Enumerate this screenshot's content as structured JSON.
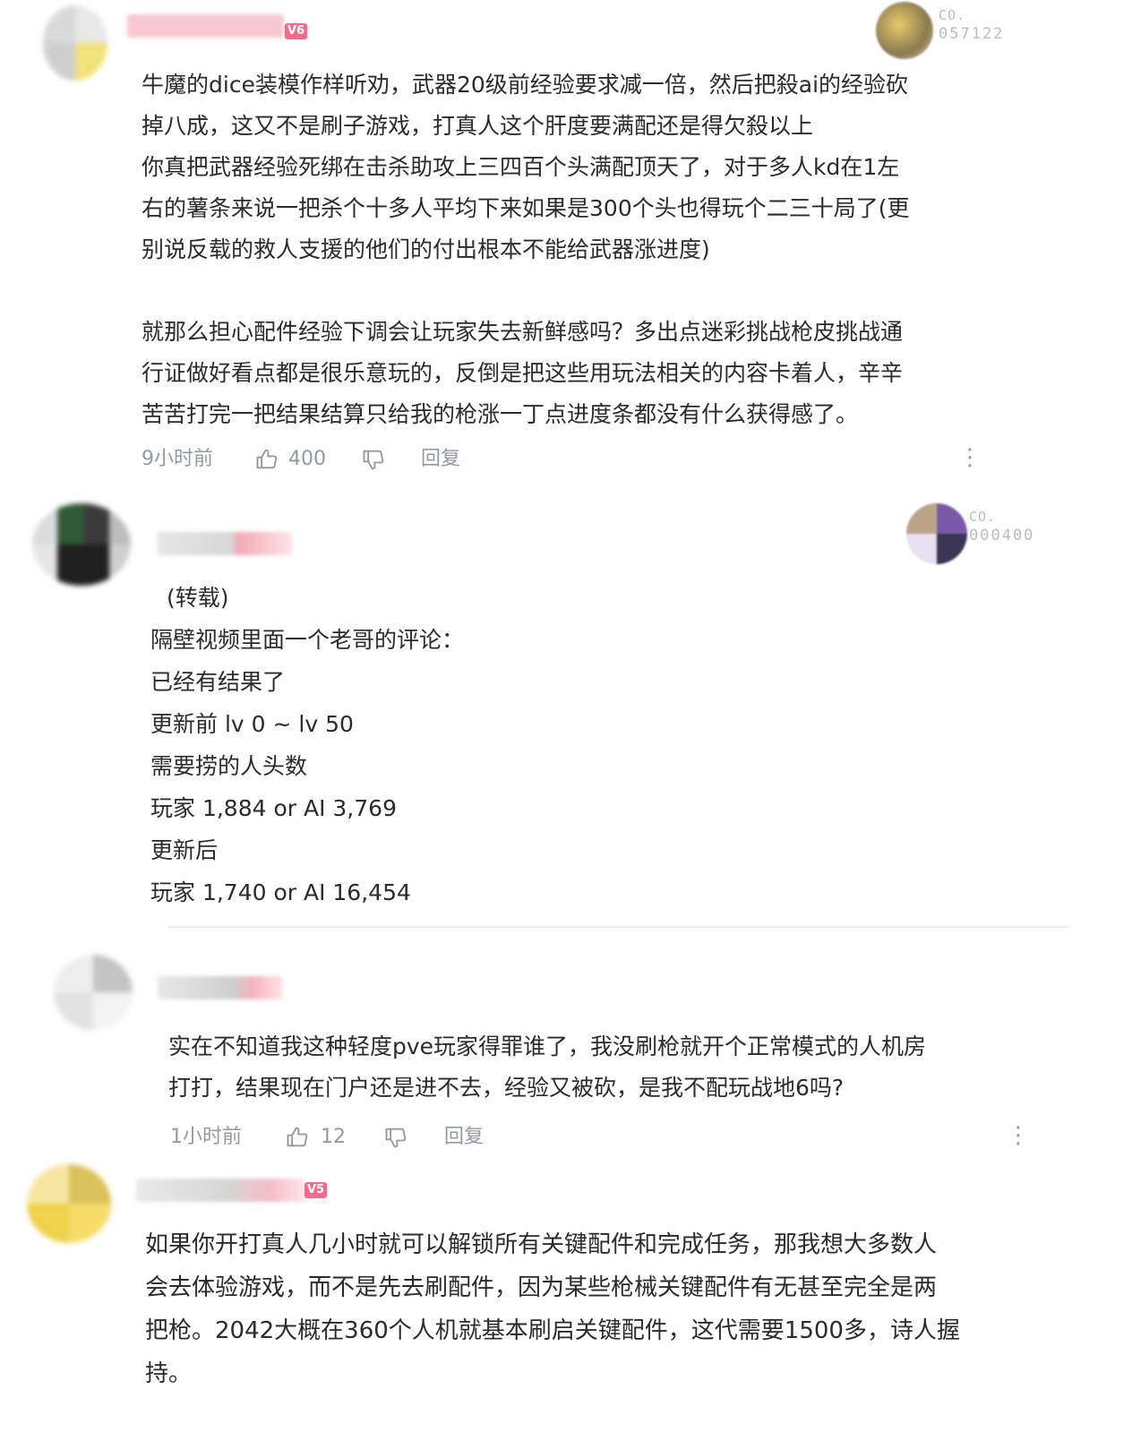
{
  "comments": [
    {
      "level": "V6",
      "fan_badge": {
        "prefix": "CO.",
        "number": "057122"
      },
      "lines": [
        "牛魔的dice装模作样听劝，武器20级前经验要求减一倍，然后把殺ai的经验砍",
        "掉八成，这又不是刷子游戏，打真人这个肝度要满配还是得欠殺以上",
        "你真把武器经验死绑在击杀助攻上三四百个头满配顶天了，对于多人kd在1左",
        "右的薯条来说一把杀个十多人平均下来如果是300个头也得玩个二三十局了(更",
        "别说反载的救人支援的他们的付出根本不能给武器涨进度)",
        "就那么担心配件经验下调会让玩家失去新鲜感吗？多出点迷彩挑战枪皮挑战通",
        "行证做好看点都是很乐意玩的，反倒是把这些用玩法相关的内容卡着人，辛辛",
        "苦苦打完一把结果结算只给我的枪涨一丁点进度条都没有什么获得感了。"
      ],
      "time": "9小时前",
      "likes": "400",
      "reply_label": "回复"
    },
    {
      "fan_badge": {
        "prefix": "CO.",
        "number": "000400"
      },
      "lines": [
        "(转载)",
        "隔壁视频里面一个老哥的评论：",
        "已经有结果了",
        "更新前 lv 0 ~ lv 50",
        "需要捞的人头数",
        "玩家 1,884 or AI 3,769",
        "更新后",
        "玩家 1,740 or AI 16,454"
      ]
    },
    {
      "lines": [
        "实在不知道我这种轻度pve玩家得罪谁了，我没刷枪就开个正常模式的人机房",
        "打打，结果现在门户还是进不去，经验又被砍，是我不配玩战地6吗?"
      ],
      "time": "1小时前",
      "likes": "12",
      "reply_label": "回复"
    },
    {
      "level": "V5",
      "lines": [
        "如果你开打真人几小时就可以解锁所有关键配件和完成任务，那我想大多数人",
        "会去体验游戏，而不是先去刷配件，因为某些枪械关键配件有无甚至完全是两",
        "把枪。2042大概在360个人机就基本刷启关键配件，这代需要1500多，诗人握",
        "持。"
      ]
    }
  ],
  "icons": [
    "thumbs-up-icon",
    "thumbs-down-icon",
    "more-vertical-icon"
  ],
  "colors": {
    "text": "#2b2b2b",
    "meta": "#9499a0",
    "level_badge": "#f26b8a",
    "divider": "#eceef2"
  }
}
